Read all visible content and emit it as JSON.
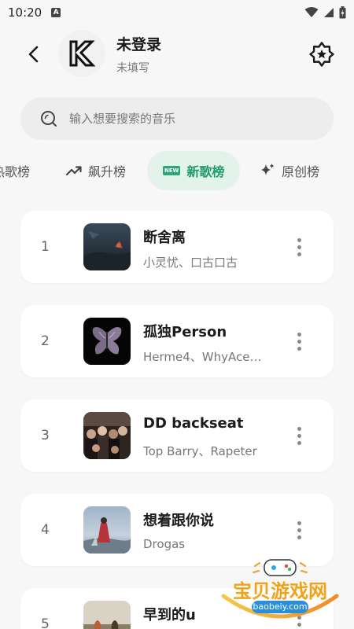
{
  "status_bar": {
    "time": "10:20",
    "notification_letter": "A",
    "icons": [
      "wifi-icon",
      "signal-icon",
      "battery-icon"
    ]
  },
  "header": {
    "user_name": "未登录",
    "user_subtitle": "未填写",
    "logo_letter": "K"
  },
  "search": {
    "placeholder": "输入想要搜索的音乐"
  },
  "tabs": [
    {
      "label": "热歌榜",
      "icon": "fire-icon",
      "active": false
    },
    {
      "label": "飙升榜",
      "icon": "trending-up-icon",
      "active": false
    },
    {
      "label": "新歌榜",
      "icon": "new-badge-icon",
      "active": true
    },
    {
      "label": "原创榜",
      "icon": "sparkle-icon",
      "active": false
    }
  ],
  "new_badge_text": "NEW",
  "songs": [
    {
      "rank": "1",
      "title": "断舍离",
      "artist": "小灵忧、口古口古"
    },
    {
      "rank": "2",
      "title": "孤独Person",
      "artist": "Herme4、WhyAce…"
    },
    {
      "rank": "3",
      "title": "DD backseat",
      "artist": "Top Barry、Rapeter"
    },
    {
      "rank": "4",
      "title": "想着跟你说",
      "artist": "Drogas"
    },
    {
      "rank": "5",
      "title": "早到的u",
      "artist": ""
    }
  ],
  "watermark": {
    "title": "宝贝游戏网",
    "url": "baobeiy.com"
  },
  "colors": {
    "accent": "#1f9a6a",
    "accent_bg": "#e3f3ec",
    "page_bg": "#f7f7f7"
  }
}
